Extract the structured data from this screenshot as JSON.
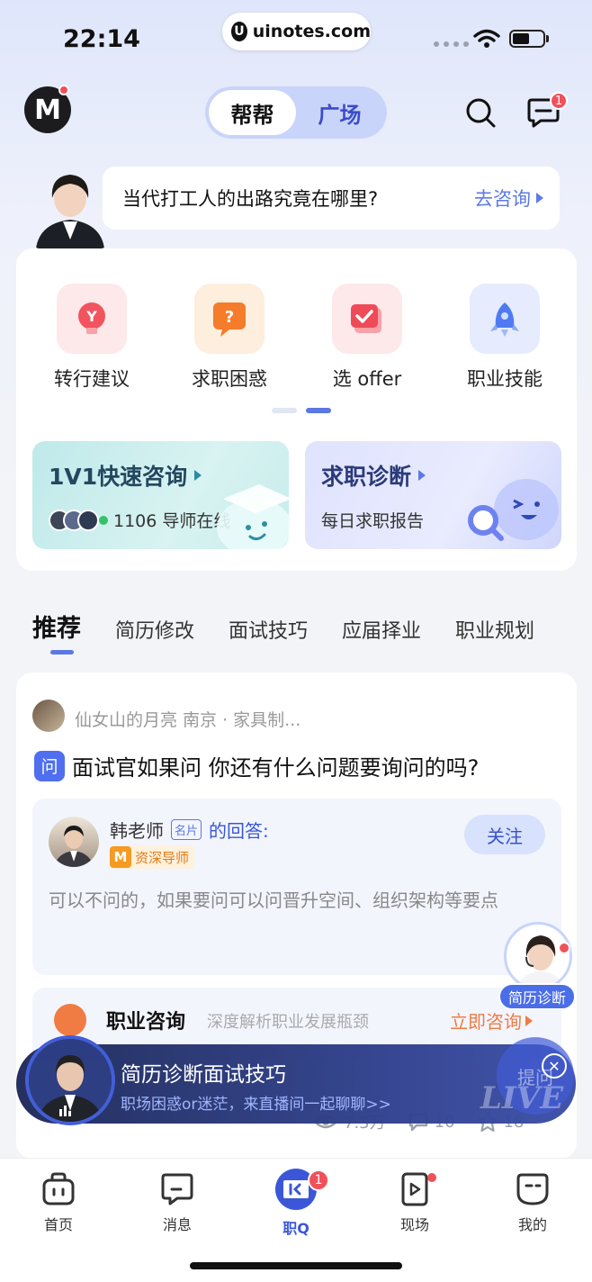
{
  "status_bar": {
    "time": "22:14",
    "url": "uinotes.com",
    "url_logo": "U"
  },
  "header": {
    "logo_letter": "M",
    "segments": [
      "帮帮",
      "广场"
    ],
    "active_segment": 0,
    "message_badge": "1"
  },
  "banner": {
    "question": "当代打工人的出路究竟在哪里?",
    "link_label": "去咨询"
  },
  "categories": [
    {
      "label": "转行建议",
      "icon": "lightbulb-icon"
    },
    {
      "label": "求职困惑",
      "icon": "question-icon"
    },
    {
      "label": "选 offer",
      "icon": "check-icon"
    },
    {
      "label": "职业技能",
      "icon": "rocket-icon"
    }
  ],
  "pager": {
    "pages": 2,
    "active": 1
  },
  "promos": {
    "left": {
      "title": "1V1快速咨询",
      "sub": "1106 导师在线"
    },
    "right": {
      "title": "求职诊断",
      "sub": "每日求职报告"
    }
  },
  "tabs": [
    "推荐",
    "简历修改",
    "面试技巧",
    "应届择业",
    "职业规划"
  ],
  "post": {
    "author": "仙女山的月亮   南京 · 家具制...",
    "question_tag": "问",
    "question": "面试官如果问 你还有什么问题要询问的吗?",
    "answer": {
      "teacher": "韩老师",
      "card_tag": "名片",
      "answer_label": "的回答:",
      "badge_letter": "M",
      "badge": "资深导师",
      "follow_label": "关注",
      "text": "可以不问的，如果要问可以问晋升空间、组织架构等要点"
    }
  },
  "consult": {
    "title": "职业咨询",
    "subtitle": "深度解析职业发展瓶颈",
    "link_label": "立即咨询"
  },
  "stats": {
    "views": "7.3万",
    "comments": "10",
    "stars": "18"
  },
  "float_advisor": {
    "label": "简历诊断"
  },
  "live": {
    "title": "简历诊断面试技巧",
    "subtitle": "职场困惑or迷茫，来直播间一起聊聊>>",
    "ask_label": "提问",
    "watermark": "LIVE"
  },
  "nav": {
    "items": [
      {
        "label": "首页"
      },
      {
        "label": "消息"
      },
      {
        "label": "职Q",
        "badge": "1"
      },
      {
        "label": "现场"
      },
      {
        "label": "我的"
      }
    ],
    "active": 2
  },
  "colors": {
    "accent": "#5b78e3",
    "badge": "#f0505a",
    "orange": "#f07c44"
  }
}
